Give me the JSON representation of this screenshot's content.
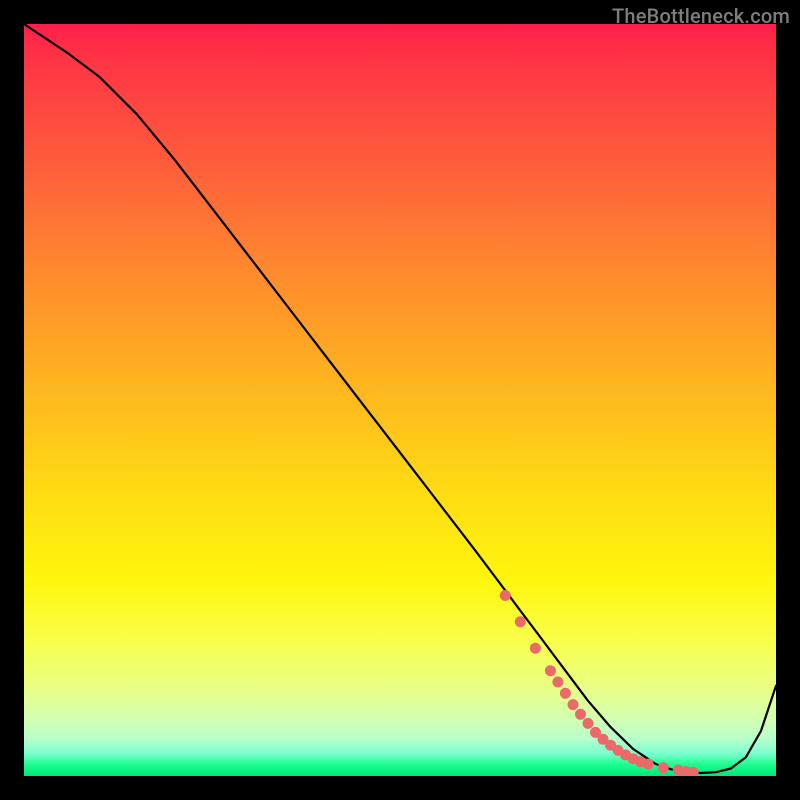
{
  "watermark": "TheBottleneck.com",
  "chart_data": {
    "type": "line",
    "title": "",
    "xlabel": "",
    "ylabel": "",
    "xlim": [
      0,
      100
    ],
    "ylim": [
      0,
      100
    ],
    "series": [
      {
        "name": "bottleneck-curve",
        "x": [
          0,
          3,
          6,
          10,
          15,
          20,
          25,
          30,
          35,
          40,
          45,
          50,
          55,
          60,
          63,
          66,
          69,
          72,
          75,
          78,
          81,
          84,
          86,
          88,
          90,
          92,
          94,
          96,
          98,
          100
        ],
        "y": [
          100,
          98,
          96,
          93,
          88,
          82,
          75.5,
          69,
          62.5,
          56,
          49.5,
          43,
          36.5,
          30,
          26,
          22,
          18,
          14,
          10,
          6.5,
          3.6,
          1.6,
          0.9,
          0.5,
          0.4,
          0.5,
          1.0,
          2.5,
          6.0,
          12
        ]
      }
    ],
    "markers": {
      "name": "highlight-dots",
      "x": [
        64,
        66,
        68,
        70,
        71,
        72,
        73,
        74,
        75,
        76,
        77,
        78,
        79,
        80,
        81,
        82,
        83,
        85,
        87,
        88,
        89
      ],
      "y": [
        24,
        20.5,
        17,
        14,
        12.5,
        11,
        9.5,
        8.2,
        7.0,
        5.8,
        4.9,
        4.1,
        3.4,
        2.8,
        2.3,
        1.9,
        1.6,
        1.1,
        0.8,
        0.6,
        0.5
      ]
    },
    "background": {
      "type": "vertical-gradient",
      "stops": [
        {
          "pos": 0.0,
          "color": "#ff1f4b"
        },
        {
          "pos": 0.33,
          "color": "#ff8a2e"
        },
        {
          "pos": 0.62,
          "color": "#ffdb14"
        },
        {
          "pos": 0.88,
          "color": "#e9ff83"
        },
        {
          "pos": 1.0,
          "color": "#00e676"
        }
      ]
    }
  }
}
